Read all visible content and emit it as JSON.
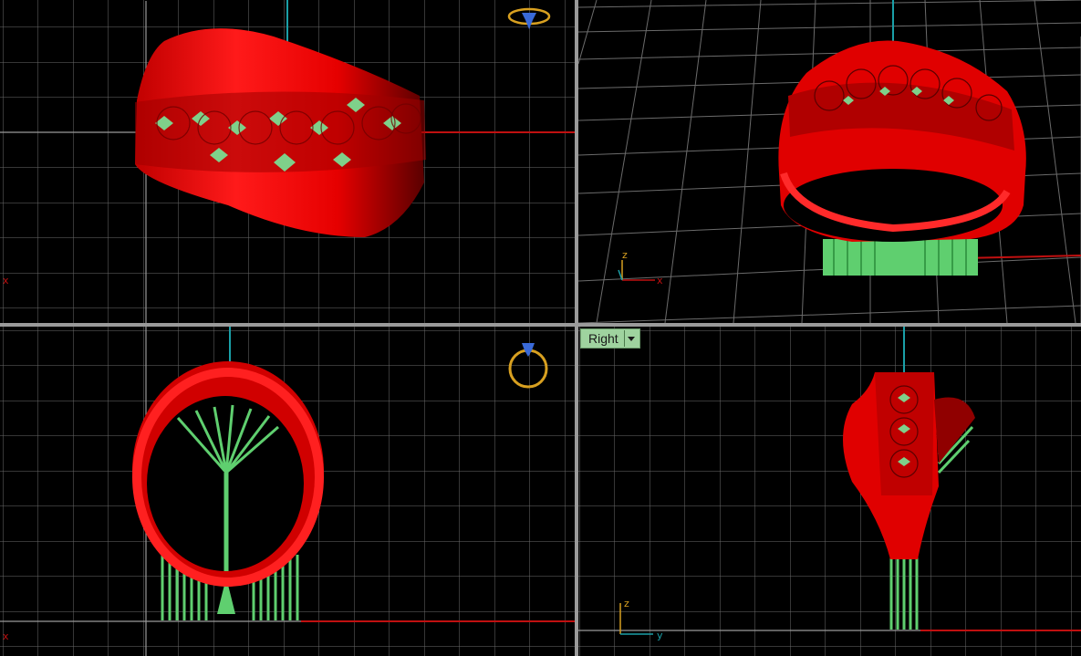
{
  "viewports": {
    "top": {
      "label": ""
    },
    "perspective": {
      "label": "",
      "axes": {
        "z": "z",
        "x": "x"
      }
    },
    "front": {
      "label": "",
      "axes": {
        "x": "x"
      }
    },
    "right": {
      "label": "Right",
      "axes": {
        "z": "z",
        "y": "y"
      }
    }
  },
  "top_axes": {
    "x": "x"
  },
  "colors": {
    "background": "#000000",
    "grid": "#6b6b6b",
    "model": "#e00000",
    "supports": "#5fcf6f",
    "axis_x": "#c01010",
    "axis_vertical": "#1aa0a8",
    "label_bg": "#9fd39f"
  },
  "icons": {
    "top_viewcube": "ring-gem-icon",
    "front_viewcube": "ring-gem-icon"
  }
}
